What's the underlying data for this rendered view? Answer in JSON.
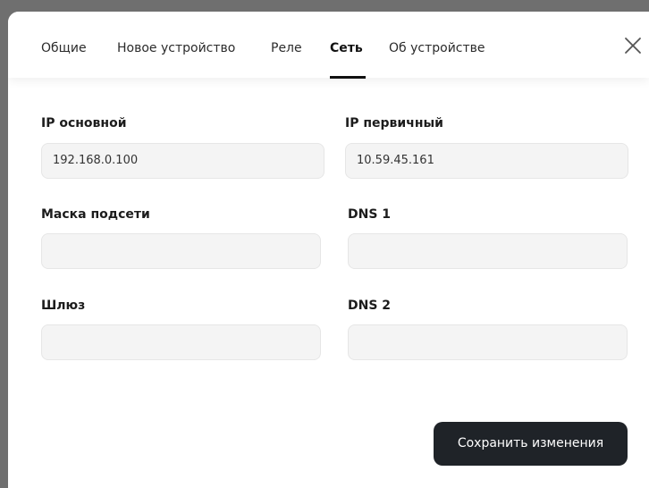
{
  "tabs": [
    {
      "label": "Общие",
      "active": false
    },
    {
      "label": "Новое устройство",
      "active": false
    },
    {
      "label": "Реле",
      "active": false
    },
    {
      "label": "Сеть",
      "active": true
    },
    {
      "label": "Об устройстве",
      "active": false
    }
  ],
  "close_icon": "close-icon",
  "fields": {
    "ip_primary_main": {
      "label": "IP основной",
      "value": "192.168.0.100"
    },
    "ip_primary": {
      "label": "IP первичный",
      "value": "10.59.45.161"
    },
    "subnet_mask": {
      "label": "Маска подсети",
      "value": ""
    },
    "dns1": {
      "label": "DNS 1",
      "value": ""
    },
    "gateway": {
      "label": "Шлюз",
      "value": ""
    },
    "dns2": {
      "label": "DNS 2",
      "value": ""
    }
  },
  "save_button": {
    "label": "Сохранить изменения"
  },
  "colors": {
    "accent_dark": "#1f2328",
    "input_bg": "#f4f4f4",
    "backdrop": "#6f6f6f"
  }
}
